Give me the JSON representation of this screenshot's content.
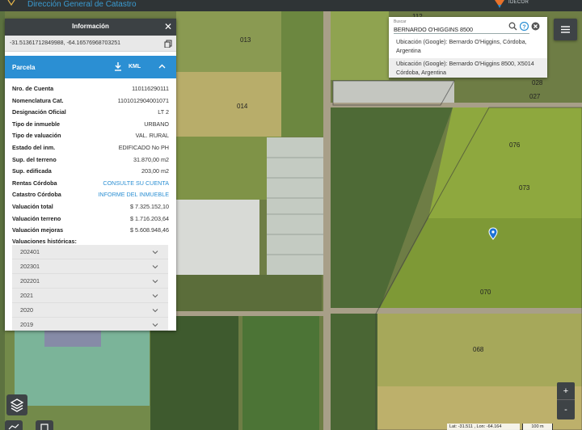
{
  "header": {
    "subtitle": "Dirección General de Catastro",
    "idecor_label": "IDECOR"
  },
  "map": {
    "parcel_labels": [
      "013",
      "014",
      "112",
      "028",
      "027",
      "076",
      "073",
      "070",
      "068"
    ]
  },
  "search": {
    "label": "Buscar",
    "value": "BERNARDO O'HIGGINS 8500",
    "suggestions": [
      "Ubicación (Google): Bernardo O'Higgins, Córdoba, Argentina",
      "Ubicación (Google): Bernardo O'Higgins 8500, X5014 Córdoba, Argentina"
    ]
  },
  "panel": {
    "title": "Información",
    "coordinates": "-31.51361712849988, -64.16576968703251",
    "section": "Parcela",
    "kml_label": "KML",
    "fields": [
      {
        "label": "Nro. de Cuenta",
        "value": "110116290111"
      },
      {
        "label": "Nomenclatura Cat.",
        "value": "1101012904001071"
      },
      {
        "label": "Designación Oficial",
        "value": "LT 2"
      },
      {
        "label": "Tipo de inmueble",
        "value": "URBANO"
      },
      {
        "label": "Tipo de valuación",
        "value": "VAL. RURAL"
      },
      {
        "label": "Estado del inm.",
        "value": "EDIFICADO No PH"
      },
      {
        "label": "Sup. del terreno",
        "value": "31.870,00 m2"
      },
      {
        "label": "Sup. edificada",
        "value": "203,00 m2"
      },
      {
        "label": "Rentas Córdoba",
        "value": "CONSULTE SU CUENTA"
      },
      {
        "label": "Catastro Córdoba",
        "value": "INFORME DEL INMUEBLE"
      },
      {
        "label": "Valuación total",
        "value": "$ 7.325.152,10"
      },
      {
        "label": "Valuación terreno",
        "value": "$ 1.716.203,64"
      },
      {
        "label": "Valuación mejoras",
        "value": "$ 5.608.948,46"
      }
    ],
    "historicas_title": "Valuaciones históricas:",
    "historicas": [
      "202401",
      "202301",
      "202201",
      "2021",
      "2020",
      "2019"
    ]
  },
  "controls": {
    "zoom_in": "+",
    "zoom_out": "-"
  },
  "status": {
    "latlon": "Lat: -31.511 , Lon: -64.164",
    "scale": "100 m"
  },
  "colors": {
    "accent": "#2b8fd3",
    "panel_header": "#3c4144",
    "marker": "#1e73d8"
  }
}
